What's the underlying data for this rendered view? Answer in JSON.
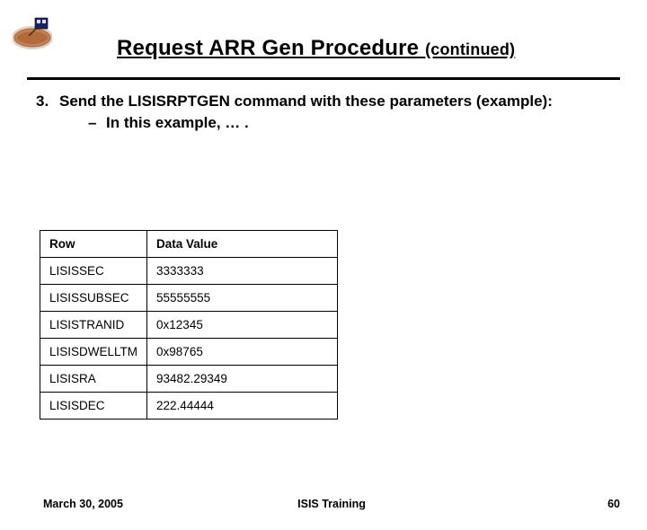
{
  "header": {
    "title_main": "Request ARR Gen Procedure ",
    "title_cont": "(continued)"
  },
  "body": {
    "item_number": "3.",
    "item_text": "Send the LISISRPTGEN command with these parameters (example):",
    "sub_dash": "–",
    "sub_text": "In this example, … ."
  },
  "table": {
    "headers": {
      "row": "Row",
      "value": "Data Value"
    },
    "rows": [
      {
        "row": "LISISSEC",
        "value": "3333333"
      },
      {
        "row": "LISISSUBSEC",
        "value": "55555555"
      },
      {
        "row": "LISISTRANID",
        "value": "0x12345"
      },
      {
        "row": "LISISDWELLTM",
        "value": "0x98765"
      },
      {
        "row": "LISISRA",
        "value": "93482.29349"
      },
      {
        "row": "LISISDEC",
        "value": "222.44444"
      }
    ]
  },
  "footer": {
    "date": "March 30, 2005",
    "center": "ISIS Training",
    "page": "60"
  },
  "icons": {
    "logo": "logo-icon"
  }
}
